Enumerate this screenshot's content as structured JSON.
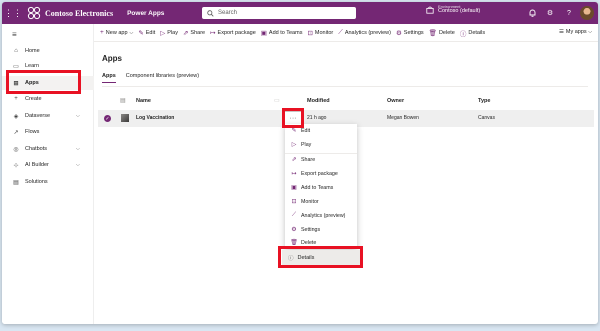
{
  "header": {
    "brand": "Contoso Electronics",
    "product": "Power Apps",
    "search_placeholder": "Search",
    "environment_label": "Environment",
    "environment_name": "Contoso (default)",
    "help_glyph": "?",
    "colors": {
      "header_bg": "#742774",
      "accent": "#742774",
      "highlight": "#e81123"
    }
  },
  "sidebar": {
    "items": [
      {
        "label": "Home",
        "icon": "home-icon"
      },
      {
        "label": "Learn",
        "icon": "book-icon"
      },
      {
        "label": "Apps",
        "icon": "apps-icon"
      },
      {
        "label": "Create",
        "icon": "plus-icon"
      },
      {
        "label": "Dataverse",
        "icon": "database-icon"
      },
      {
        "label": "Flows",
        "icon": "flow-icon"
      },
      {
        "label": "Chatbots",
        "icon": "chatbot-icon"
      },
      {
        "label": "AI Builder",
        "icon": "ai-icon"
      },
      {
        "label": "Solutions",
        "icon": "solutions-icon"
      }
    ]
  },
  "toolbar": {
    "new_app": "New app",
    "edit": "Edit",
    "play": "Play",
    "share": "Share",
    "export": "Export package",
    "teams": "Add to Teams",
    "monitor": "Monitor",
    "analytics": "Analytics (preview)",
    "settings": "Settings",
    "delete": "Delete",
    "details": "Details",
    "my_apps": "My apps"
  },
  "main": {
    "title": "Apps",
    "tabs": [
      "Apps",
      "Component libraries (preview)"
    ],
    "columns": {
      "name": "Name",
      "modified": "Modified",
      "owner": "Owner",
      "type": "Type"
    },
    "rows": [
      {
        "name": "Log Vaccination",
        "modified": "21 h ago",
        "owner": "Megan Bowen",
        "type": "Canvas"
      }
    ],
    "more_glyph": "···"
  },
  "context_menu": {
    "items": [
      {
        "label": "Edit",
        "icon": "pencil-icon"
      },
      {
        "label": "Play",
        "icon": "play-icon"
      },
      {
        "label": "Share",
        "icon": "share-icon"
      },
      {
        "label": "Export package",
        "icon": "export-icon"
      },
      {
        "label": "Add to Teams",
        "icon": "teams-icon"
      },
      {
        "label": "Monitor",
        "icon": "monitor-icon"
      },
      {
        "label": "Analytics (preview)",
        "icon": "analytics-icon"
      },
      {
        "label": "Settings",
        "icon": "gear-icon"
      },
      {
        "label": "Delete",
        "icon": "trash-icon"
      },
      {
        "label": "Details",
        "icon": "info-icon"
      }
    ]
  }
}
